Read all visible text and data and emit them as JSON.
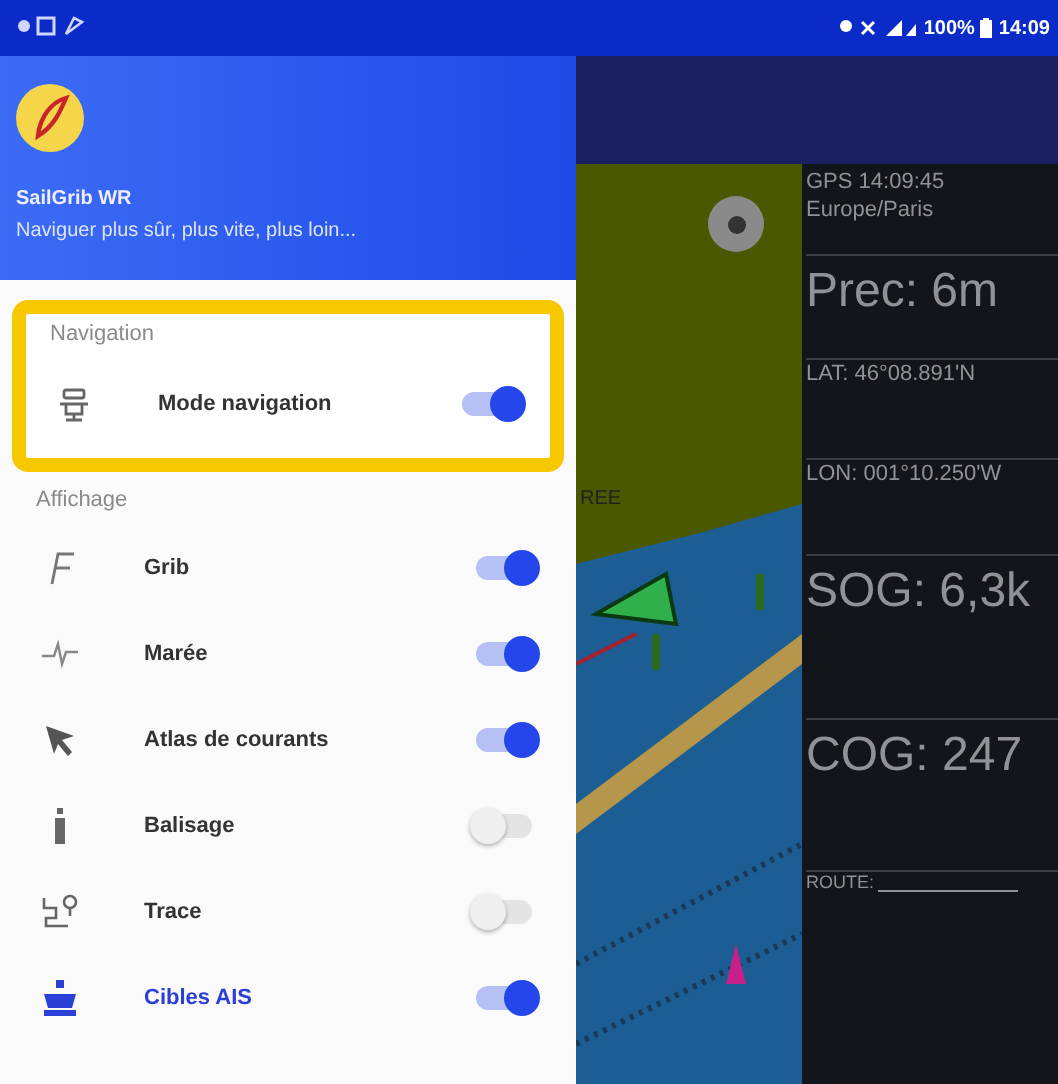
{
  "status_bar": {
    "battery": "100%",
    "time": "14:09"
  },
  "drawer": {
    "app_name": "SailGrib WR",
    "tagline": "Naviguer plus sûr, plus vite, plus loin...",
    "sections": [
      {
        "title": "Navigation",
        "highlighted": true,
        "items": [
          {
            "label": "Mode navigation",
            "on": true,
            "selected": false
          }
        ]
      },
      {
        "title": "Affichage",
        "highlighted": false,
        "items": [
          {
            "label": "Grib",
            "on": true,
            "selected": false
          },
          {
            "label": "Marée",
            "on": true,
            "selected": false
          },
          {
            "label": "Atlas de courants",
            "on": true,
            "selected": false
          },
          {
            "label": "Balisage",
            "on": false,
            "selected": false
          },
          {
            "label": "Trace",
            "on": false,
            "selected": false
          },
          {
            "label": "Cibles AIS",
            "on": true,
            "selected": true
          }
        ]
      }
    ]
  },
  "map": {
    "labels": [
      "REE"
    ]
  },
  "instruments": [
    {
      "kind": "small",
      "lines": [
        "GPS 14:09:45",
        "Europe/Paris"
      ]
    },
    {
      "kind": "large",
      "lines": [
        "Prec: 6m"
      ]
    },
    {
      "kind": "small",
      "lines": [
        "LAT: 46°08.891'N"
      ]
    },
    {
      "kind": "small",
      "lines": [
        "LON: 001°10.250'W"
      ]
    },
    {
      "kind": "large",
      "lines": [
        "SOG: 6,3k"
      ]
    },
    {
      "kind": "large",
      "lines": [
        "COG: 247"
      ]
    },
    {
      "kind": "route",
      "lines": [
        "ROUTE:"
      ]
    }
  ]
}
